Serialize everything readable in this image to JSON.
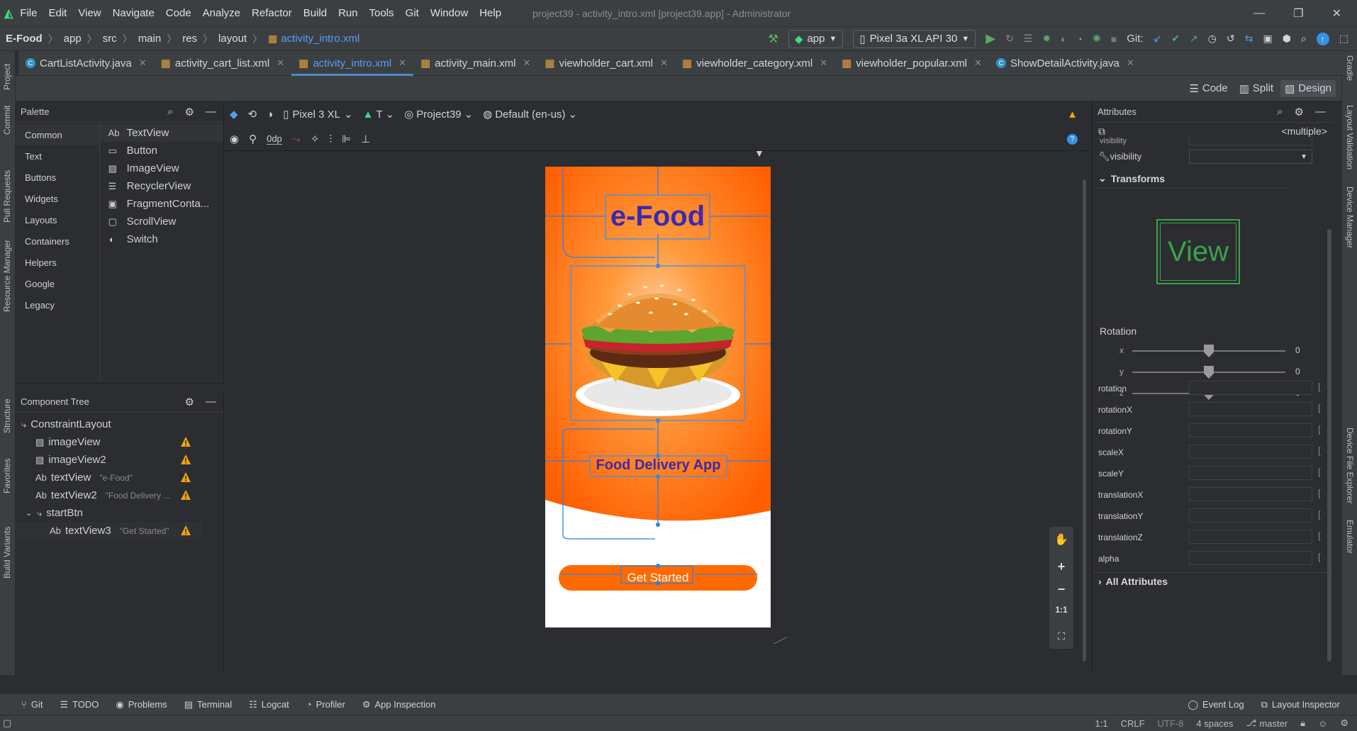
{
  "titlebar": {
    "menu": [
      "File",
      "Edit",
      "View",
      "Navigate",
      "Code",
      "Analyze",
      "Refactor",
      "Build",
      "Run",
      "Tools",
      "Git",
      "Window",
      "Help"
    ],
    "title": "project39 - activity_intro.xml [project39.app] - Administrator"
  },
  "navbar": {
    "breadcrumb": [
      "E-Food",
      "app",
      "src",
      "main",
      "res",
      "layout",
      "activity_intro.xml"
    ],
    "run_config": "app",
    "device": "Pixel 3a XL API 30",
    "git_label": "Git:"
  },
  "tabs": [
    {
      "label": "CartListActivity.java",
      "kind": "java"
    },
    {
      "label": "activity_cart_list.xml",
      "kind": "xml"
    },
    {
      "label": "activity_intro.xml",
      "kind": "xml",
      "active": true
    },
    {
      "label": "activity_main.xml",
      "kind": "xml"
    },
    {
      "label": "viewholder_cart.xml",
      "kind": "xml"
    },
    {
      "label": "viewholder_category.xml",
      "kind": "xml"
    },
    {
      "label": "viewholder_popular.xml",
      "kind": "xml"
    },
    {
      "label": "ShowDetailActivity.java",
      "kind": "java"
    }
  ],
  "modes": {
    "code": "Code",
    "split": "Split",
    "design": "Design"
  },
  "left_stripe": [
    "Project",
    "Commit",
    "Pull Requests",
    "Resource Manager",
    "Structure",
    "Favorites",
    "Build Variants"
  ],
  "right_stripe": [
    "Gradle",
    "Layout Validation",
    "Device Manager",
    "Device File Explorer",
    "Emulator"
  ],
  "palette": {
    "title": "Palette",
    "categories": [
      "Common",
      "Text",
      "Buttons",
      "Widgets",
      "Layouts",
      "Containers",
      "Helpers",
      "Google",
      "Legacy"
    ],
    "components": [
      {
        "label": "TextView",
        "prefix": "Ab"
      },
      {
        "label": "Button"
      },
      {
        "label": "ImageView"
      },
      {
        "label": "RecyclerView"
      },
      {
        "label": "FragmentConta..."
      },
      {
        "label": "ScrollView"
      },
      {
        "label": "Switch"
      }
    ]
  },
  "design_toolbar": {
    "device": "Pixel 3 XL",
    "theme": "T",
    "project": "Project39",
    "locale": "Default (en-us)",
    "margin": "0dp"
  },
  "component_tree": {
    "title": "Component Tree",
    "rows": [
      {
        "label": "ConstraintLayout",
        "hint": "",
        "warn": false,
        "indent": 0
      },
      {
        "label": "imageView",
        "hint": "",
        "warn": true,
        "indent": 1
      },
      {
        "label": "imageView2",
        "hint": "",
        "warn": true,
        "indent": 1
      },
      {
        "label": "textView",
        "hint": "\"e-Food\"",
        "warn": true,
        "indent": 1,
        "prefix": "Ab"
      },
      {
        "label": "textView2",
        "hint": "\"Food Delivery ...",
        "warn": true,
        "indent": 1,
        "prefix": "Ab"
      },
      {
        "label": "startBtn",
        "hint": "",
        "warn": false,
        "indent": 1
      },
      {
        "label": "textView3",
        "hint": "\"Get Started\"",
        "warn": true,
        "indent": 2,
        "prefix": "Ab"
      }
    ]
  },
  "device_screen": {
    "title": "e-Food",
    "subtitle": "Food Delivery App",
    "button": "Get Started",
    "colors": {
      "accent": "#ff6a00",
      "title": "#3a2bb0",
      "bg": "#ffffff"
    }
  },
  "zoom_controls": [
    "+",
    "−",
    "1:1"
  ],
  "attributes": {
    "title": "Attributes",
    "multiple": "<multiple>",
    "visibility_top": "visibility",
    "visibility": "visibility",
    "transforms": "Transforms",
    "view_preview": "View",
    "rotation_title": "Rotation",
    "rotation_axes": [
      {
        "axis": "x",
        "value": "0"
      },
      {
        "axis": "y",
        "value": "0"
      },
      {
        "axis": "z",
        "value": "0"
      }
    ],
    "fields": [
      "rotation",
      "rotationX",
      "rotationY",
      "scaleX",
      "scaleY",
      "translationX",
      "translationY",
      "translationZ",
      "alpha"
    ],
    "all_attributes": "All Attributes"
  },
  "bottom_tools": [
    "Git",
    "TODO",
    "Problems",
    "Terminal",
    "Logcat",
    "Profiler",
    "App Inspection"
  ],
  "bottom_right": [
    "Event Log",
    "Layout Inspector"
  ],
  "status": {
    "position": "1:1",
    "line_sep": "CRLF",
    "encoding": "UTF-8",
    "indent": "4 spaces",
    "branch": "master"
  }
}
